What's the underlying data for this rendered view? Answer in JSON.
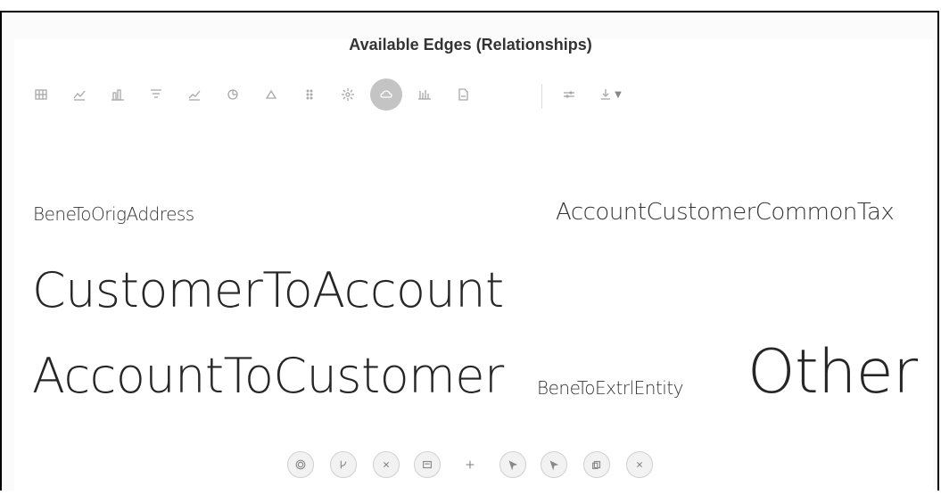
{
  "title": "Available Edges (Relationships)",
  "toolbar": {
    "buttons": [
      {
        "icon": "table-icon"
      },
      {
        "icon": "line-chart-icon"
      },
      {
        "icon": "bar-chart-icon"
      },
      {
        "icon": "funnel-chart-icon"
      },
      {
        "icon": "area-chart-icon"
      },
      {
        "icon": "pie-chart-icon"
      },
      {
        "icon": "triangle-icon"
      },
      {
        "icon": "dots-grid-icon"
      },
      {
        "icon": "sunburst-icon"
      },
      {
        "icon": "cloud-icon",
        "active": true
      },
      {
        "icon": "column-chart-icon"
      },
      {
        "icon": "report-icon"
      }
    ],
    "settings_icon": "sliders-icon",
    "download_icon": "download-icon"
  },
  "word_cloud": {
    "words": [
      {
        "text": "BeneToOrigAddress"
      },
      {
        "text": "AccountCustomerCommonTax"
      },
      {
        "text": "CustomerToAccount"
      },
      {
        "text": "AccountToCustomer"
      },
      {
        "text": "BeneToExtrlEntity"
      },
      {
        "text": "Other"
      }
    ]
  },
  "bottom_toolbar": {
    "buttons": [
      {
        "icon": "settings-icon"
      },
      {
        "icon": "branch-icon"
      },
      {
        "icon": "close-icon"
      },
      {
        "icon": "image-icon"
      },
      {
        "icon": "plus-icon"
      },
      {
        "icon": "pointer-icon"
      },
      {
        "icon": "pointer-icon"
      },
      {
        "icon": "copy-icon"
      },
      {
        "icon": "close-icon"
      }
    ]
  }
}
